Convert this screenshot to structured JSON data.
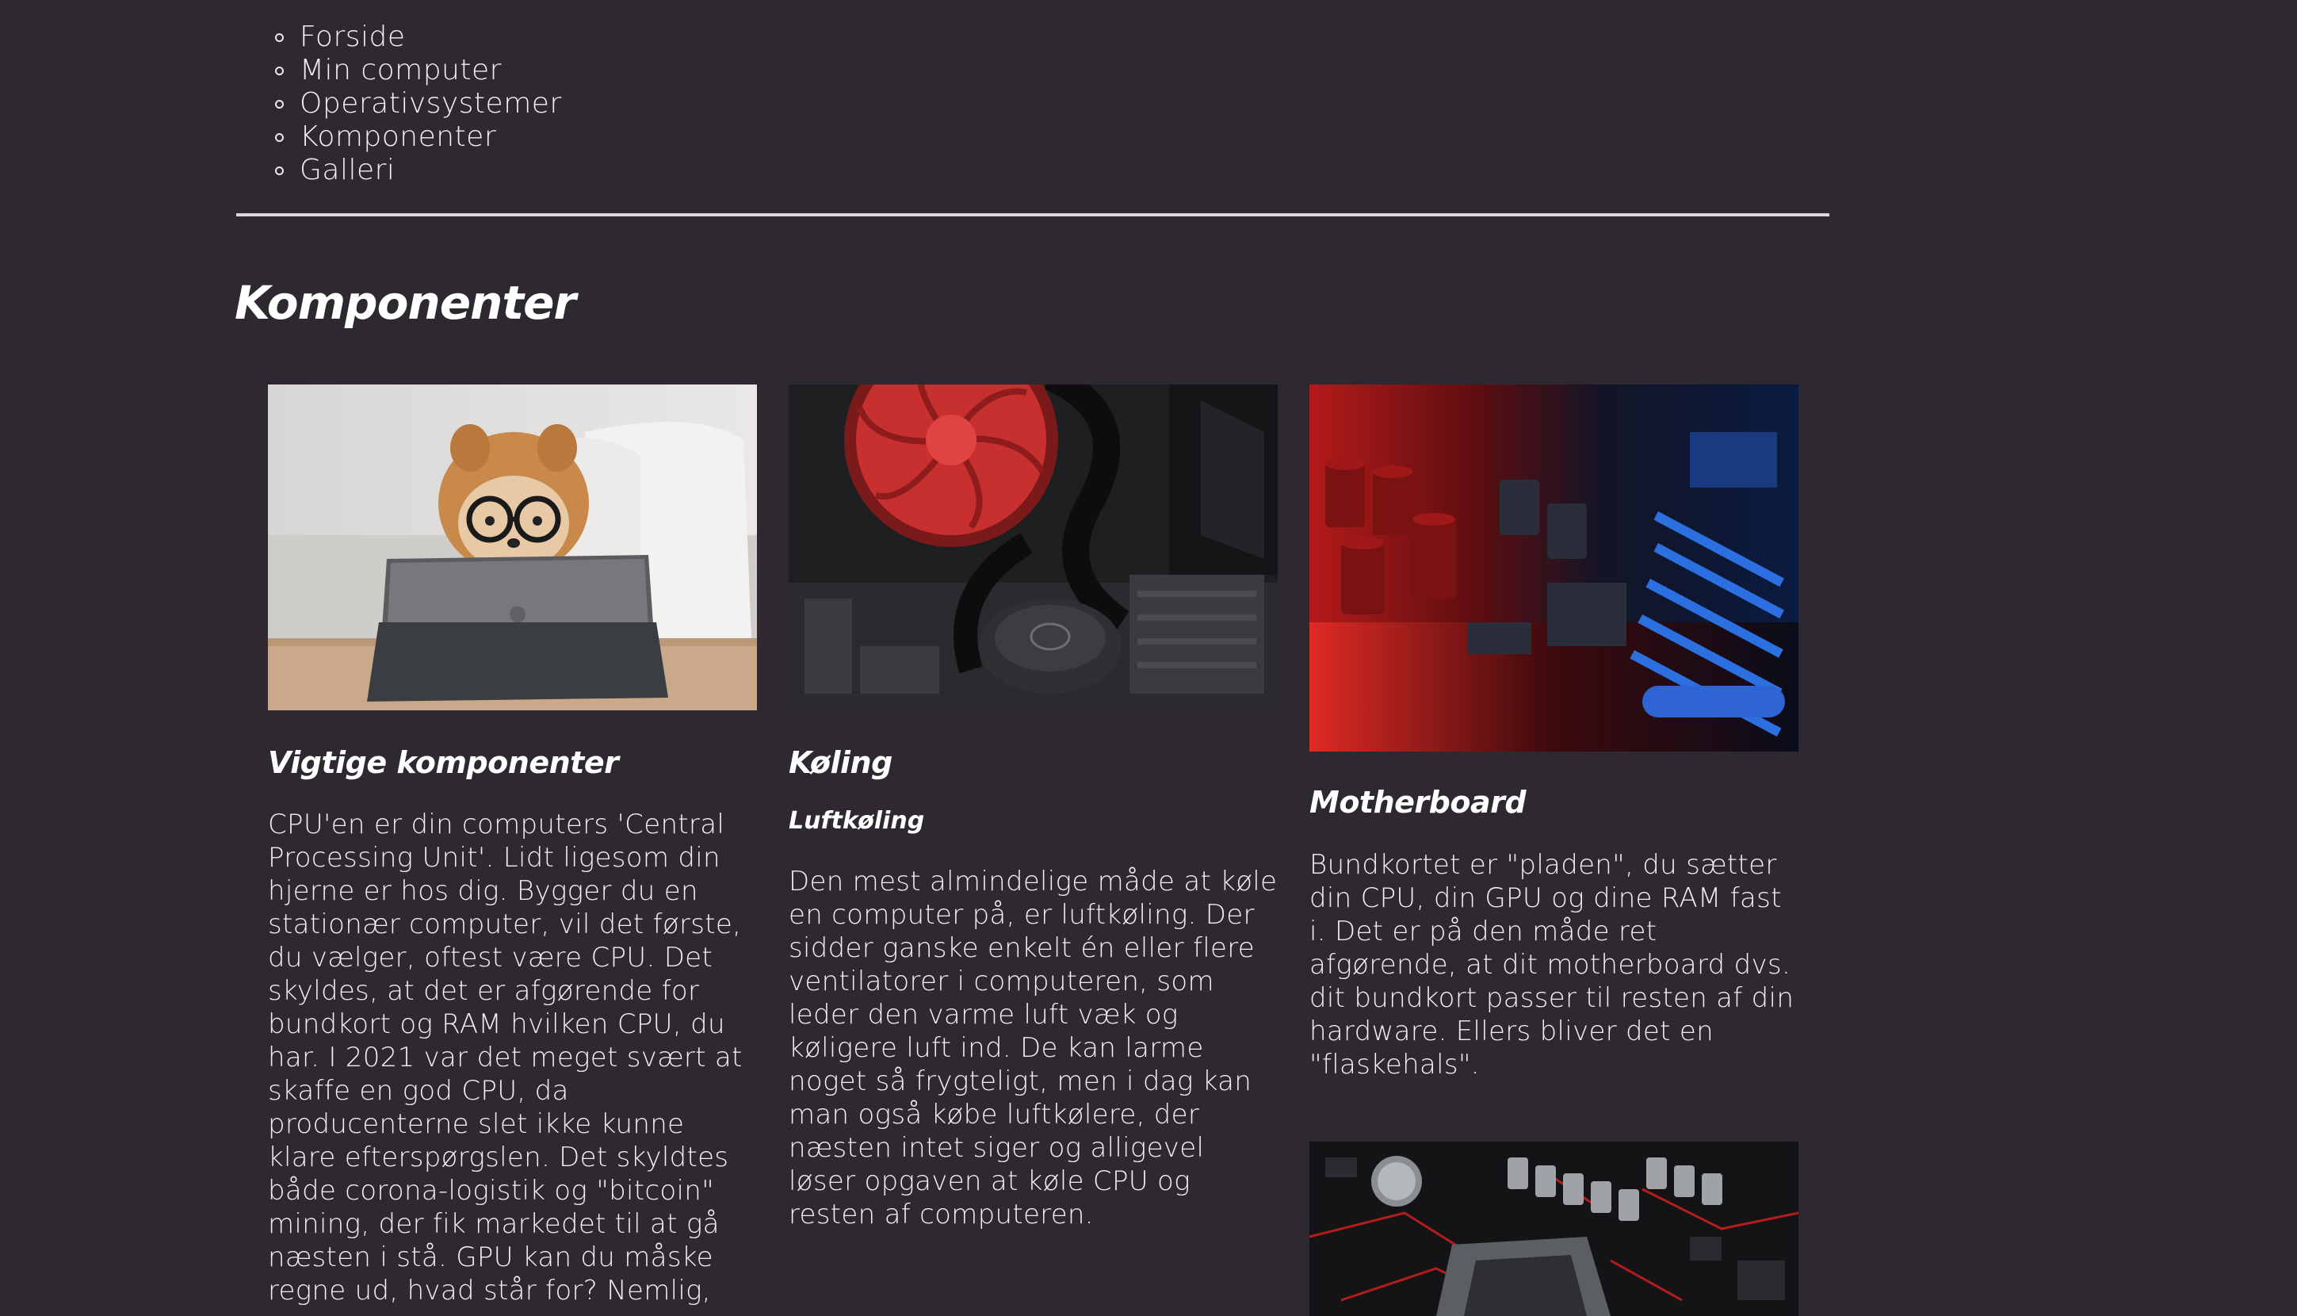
{
  "nav": {
    "items": [
      {
        "label": "Forside"
      },
      {
        "label": "Min computer"
      },
      {
        "label": "Operativsystemer"
      },
      {
        "label": "Komponenter"
      },
      {
        "label": "Galleri"
      }
    ]
  },
  "page": {
    "title": "Komponenter"
  },
  "cards": [
    {
      "image_subject": "dog-with-glasses-and-tablet",
      "heading": "Vigtige komponenter",
      "text": "CPU'en er din computers 'Central Processing Unit'. Lidt ligesom din hjerne er hos dig. Bygger du en stationær computer, vil det første, du vælger, oftest være CPU. Det skyldes, at det er afgørende for bundkort og RAM hvilken CPU, du har. I 2021 var det meget svært at skaffe en god CPU, da producenterne slet ikke kunne klare efterspørgslen. Det skyldtes både corona-logistik og \"bitcoin\" mining, der fik markedet til at gå næsten i stå. GPU kan du måske regne ud, hvad står for? Nemlig,"
    },
    {
      "image_subject": "red-cpu-cooler-fan",
      "heading": "Køling",
      "subheading": "Luftkøling",
      "text": "Den mest almindelige måde at køle en computer på, er luftkøling. Der sidder ganske enkelt én eller flere ventilatorer i computeren, som leder den varme luft væk og køligere luft ind. De kan larme noget så frygteligt, men i dag kan man også købe luftkølere, der næsten intet siger og alligevel løser opgaven at køle CPU og resten af computeren."
    },
    {
      "image_subject": "motherboard-red-blue-light",
      "heading": "Motherboard",
      "text": "Bundkortet er \"pladen\", du sætter din CPU, din GPU og dine RAM fast i. Det er på den måde ret afgørende, at dit motherboard dvs. dit bundkort passer til resten af din hardware. Ellers bliver det en \"flaskehals\".",
      "image2_subject": "motherboard-cpu-socket"
    }
  ],
  "colors": {
    "background": "#2e2830",
    "text": "#ffffff",
    "rule": "#d9d9d9"
  }
}
